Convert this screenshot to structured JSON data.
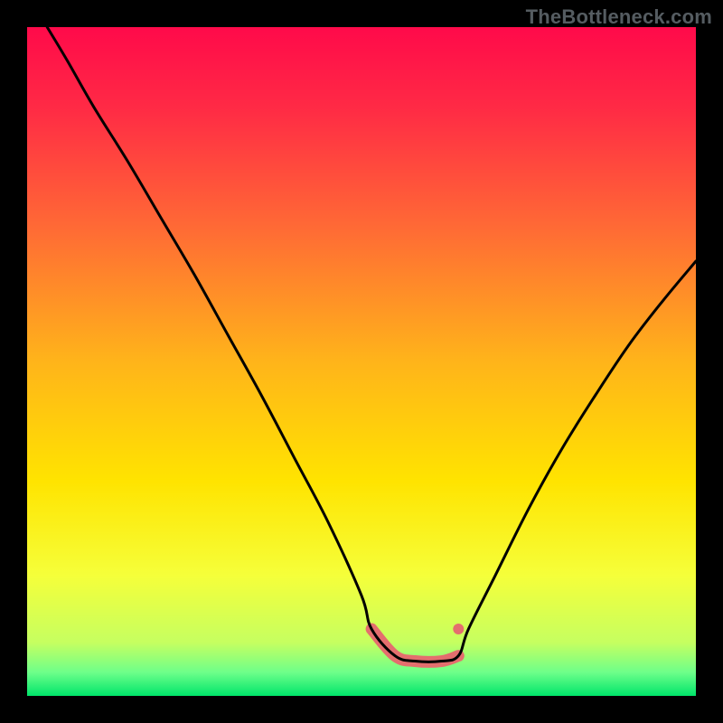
{
  "watermark": "TheBottleneck.com",
  "chart_data": {
    "type": "line",
    "title": "",
    "xlabel": "",
    "ylabel": "",
    "xlim": [
      0,
      100
    ],
    "ylim": [
      0,
      100
    ],
    "curve_x": [
      3,
      6,
      10,
      15,
      20,
      25,
      30,
      35,
      40,
      45,
      50,
      51.5,
      55,
      58,
      62,
      64.5,
      66,
      70,
      75,
      80,
      85,
      90,
      95,
      100
    ],
    "curve_y": [
      100,
      95,
      88,
      80,
      71.5,
      63,
      54,
      45,
      35.5,
      26,
      15,
      10,
      6,
      5.2,
      5.2,
      6,
      10,
      18,
      28,
      37,
      45,
      52.5,
      59,
      65
    ],
    "flat_segment": {
      "x": [
        51.5,
        55,
        58,
        62,
        64.5
      ],
      "y": [
        10,
        6,
        5.2,
        5.2,
        6
      ],
      "end_y": 10
    },
    "gradient_stops": [
      {
        "offset": 0.0,
        "color": "#ff0a4a"
      },
      {
        "offset": 0.12,
        "color": "#ff2a45"
      },
      {
        "offset": 0.3,
        "color": "#ff6a35"
      },
      {
        "offset": 0.5,
        "color": "#ffb41a"
      },
      {
        "offset": 0.68,
        "color": "#ffe400"
      },
      {
        "offset": 0.82,
        "color": "#f5ff3a"
      },
      {
        "offset": 0.92,
        "color": "#c6ff60"
      },
      {
        "offset": 0.965,
        "color": "#6dff8a"
      },
      {
        "offset": 1.0,
        "color": "#00e56a"
      }
    ],
    "highlight_color": "#e46e6e",
    "curve_color": "#000000"
  }
}
